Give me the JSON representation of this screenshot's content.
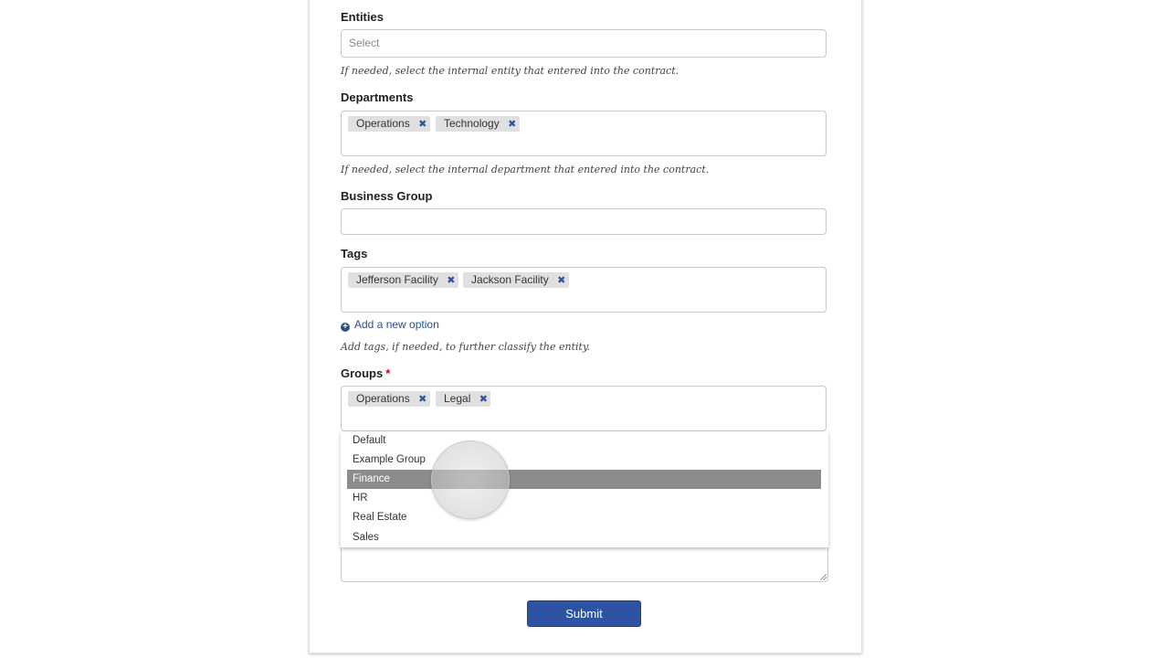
{
  "form": {
    "entities": {
      "label": "Entities",
      "placeholder": "Select",
      "help": "If needed, select the internal entity that entered into the contract."
    },
    "departments": {
      "label": "Departments",
      "chips": [
        "Operations",
        "Technology"
      ],
      "help": "If needed, select the internal department that entered into the contract."
    },
    "business_group": {
      "label": "Business Group"
    },
    "tags": {
      "label": "Tags",
      "chips": [
        "Jefferson Facility",
        "Jackson Facility"
      ],
      "add_option": "Add a new option",
      "help": "Add tags, if needed, to further classify the entity."
    },
    "groups": {
      "label": "Groups",
      "required_mark": "*",
      "chips": [
        "Operations",
        "Legal"
      ],
      "options": [
        "Default",
        "Example Group",
        "Finance",
        "HR",
        "Real Estate",
        "Sales"
      ],
      "selected_option": "Finance"
    },
    "submit_label": "Submit"
  },
  "icons": {
    "chip_remove": "close-icon",
    "add": "plus-circle-icon",
    "resize": "resize-handle-icon"
  },
  "colors": {
    "accent": "#2e53a3",
    "required": "#d0021b",
    "highlight": "#8c8c8c"
  }
}
